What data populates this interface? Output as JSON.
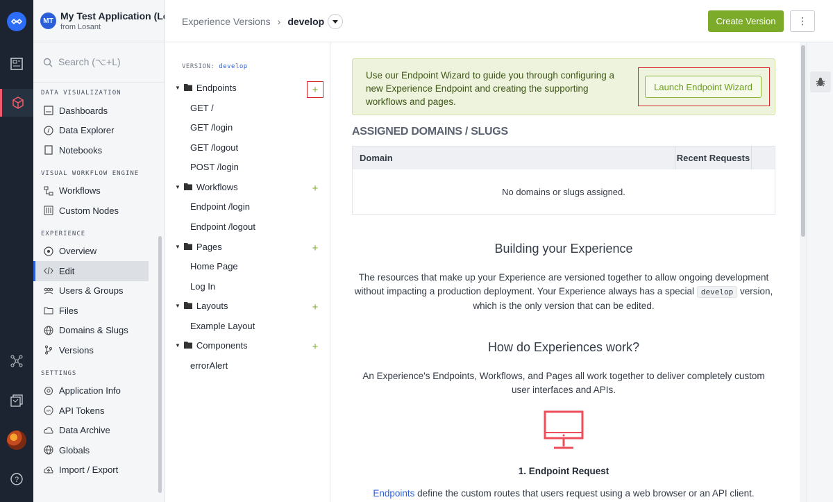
{
  "app": {
    "initials": "MT",
    "name": "My Test Application (Lo...",
    "org": "from Losant"
  },
  "search": {
    "placeholder": "Search (⌥+L)"
  },
  "nav": {
    "sections": [
      {
        "title": "DATA VISUALIZATION",
        "items": [
          "Dashboards",
          "Data Explorer",
          "Notebooks"
        ]
      },
      {
        "title": "VISUAL WORKFLOW ENGINE",
        "items": [
          "Workflows",
          "Custom Nodes"
        ]
      },
      {
        "title": "EXPERIENCE",
        "items": [
          "Overview",
          "Edit",
          "Users & Groups",
          "Files",
          "Domains & Slugs",
          "Versions"
        ]
      },
      {
        "title": "SETTINGS",
        "items": [
          "Application Info",
          "API Tokens",
          "Data Archive",
          "Globals",
          "Import / Export"
        ]
      }
    ],
    "active_item": "Edit"
  },
  "header": {
    "breadcrumb_parent": "Experience Versions",
    "breadcrumb_sep": "›",
    "breadcrumb_current": "develop",
    "create_button": "Create Version",
    "more_button": "⋮"
  },
  "tree": {
    "version_prefix": "VERSION:",
    "version_name": "develop",
    "folders": [
      {
        "name": "Endpoints",
        "items": [
          "GET /",
          "GET /login",
          "GET /logout",
          "POST /login"
        ]
      },
      {
        "name": "Workflows",
        "items": [
          "Endpoint /login",
          "Endpoint /logout"
        ]
      },
      {
        "name": "Pages",
        "items": [
          "Home Page",
          "Log In"
        ]
      },
      {
        "name": "Layouts",
        "items": [
          "Example Layout"
        ]
      },
      {
        "name": "Components",
        "items": [
          "errorAlert"
        ]
      }
    ],
    "add_symbol": "+"
  },
  "main": {
    "banner_text": "Use our Endpoint Wizard to guide you through configuring a new Experience Endpoint and creating the supporting workflows and pages.",
    "wizard_button": "Launch Endpoint Wizard",
    "assigned_heading": "ASSIGNED DOMAINS / SLUGS",
    "table_col_domain": "Domain",
    "table_col_requests": "Recent Requests",
    "table_empty": "No domains or slugs assigned.",
    "building_heading": "Building your Experience",
    "building_text_1": "The resources that make up your Experience are versioned together to allow ongoing development without impacting a production deployment. Your Experience always has a special",
    "building_code": "develop",
    "building_text_2": "version, which is the only version that can be edited.",
    "how_heading": "How do Experiences work?",
    "how_text": "An Experience's Endpoints, Workflows, and Pages all work together to deliver completely custom user interfaces and APIs.",
    "step_title": "1. Endpoint Request",
    "step_link": "Endpoints",
    "step_desc": "define the custom routes that users request using a web browser or an API client."
  },
  "colors": {
    "accent_green": "#7cab2a",
    "brand_blue": "#2b5fd9",
    "highlight_red": "#d4262b",
    "rail_bg": "#1b2430",
    "monitor_red": "#ee4d5b"
  }
}
